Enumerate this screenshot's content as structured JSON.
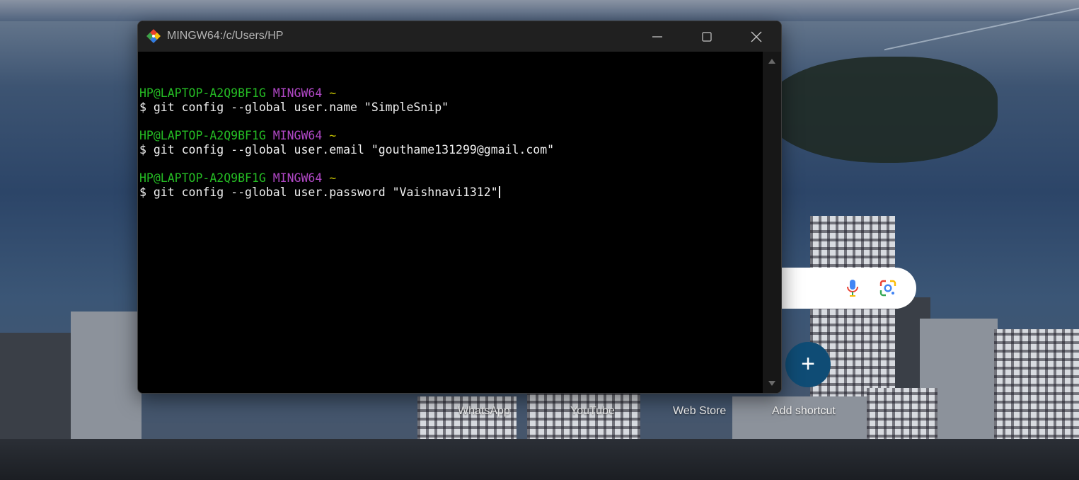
{
  "window": {
    "title": "MINGW64:/c/Users/HP",
    "controls": {
      "minimize": "minimize",
      "maximize": "maximize",
      "close": "close"
    }
  },
  "terminal": {
    "blocks": [
      {
        "user_host": "HP@LAPTOP-A2Q9BF1G",
        "env": "MINGW64",
        "dir": "~",
        "command": "$ git config --global user.name \"SimpleSnip\""
      },
      {
        "user_host": "HP@LAPTOP-A2Q9BF1G",
        "env": "MINGW64",
        "dir": "~",
        "command": "$ git config --global user.email \"gouthame131299@gmail.com\""
      },
      {
        "user_host": "HP@LAPTOP-A2Q9BF1G",
        "env": "MINGW64",
        "dir": "~",
        "command": "$ git config --global user.password \"Vaishnavi1312\""
      }
    ],
    "colors": {
      "user_host": "#25bc24",
      "env": "#b148c6",
      "dir": "#c7c400",
      "text": "#f0f0f0",
      "background": "#000000"
    }
  },
  "browser_newtab": {
    "search_icons": [
      "mic-icon",
      "google-lens-icon"
    ],
    "add_button_symbol": "+",
    "add_button_color": "#0f4c75",
    "shortcuts": [
      "WhatsApp",
      "YouTube",
      "Web Store",
      "Add shortcut"
    ]
  }
}
